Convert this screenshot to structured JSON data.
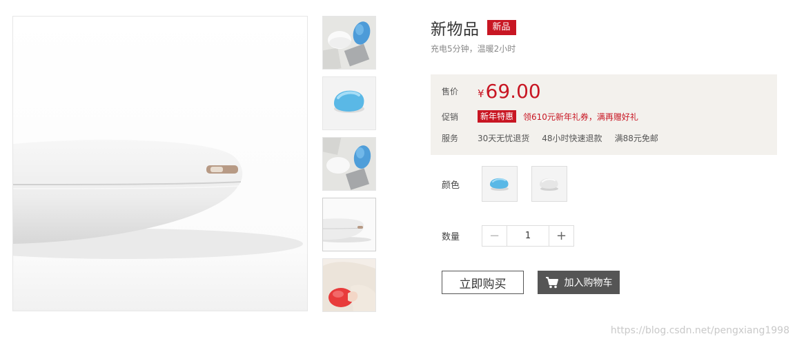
{
  "product": {
    "title": "新物品",
    "badge": "新品",
    "subtitle": "充电5分钟，温暖2小时"
  },
  "gallery": {
    "main_image": "white-hand-warmer-side-closeup",
    "thumbnails": [
      "white-and-blue-hand-warmers-with-notebook",
      "blue-hand-warmer",
      "white-and-blue-hand-warmers-with-notebook",
      "white-hand-warmer-side",
      "hand-warmer-in-hands-red"
    ]
  },
  "pricing": {
    "price_label": "售价",
    "currency": "¥",
    "price": "69.00",
    "promo_label": "促销",
    "promo_tag": "新年特惠",
    "promo_text": "领610元新年礼券，满再赠好礼",
    "service_label": "服务",
    "services": [
      "30天无忧退货",
      "48小时快速退款",
      "满88元免邮"
    ]
  },
  "options": {
    "color_label": "颜色",
    "colors": [
      "blue",
      "white"
    ],
    "quantity_label": "数量",
    "quantity": "1",
    "minus": "−",
    "plus": "+"
  },
  "actions": {
    "buy_now": "立即购买",
    "add_to_cart": "加入购物车"
  },
  "watermark": "https://blog.csdn.net/pengxiang1998",
  "colors": {
    "accent": "#c81623",
    "panel_bg": "#f3f1ed",
    "cart_button": "#555555",
    "warmer_blue": "#5ab8e6"
  }
}
